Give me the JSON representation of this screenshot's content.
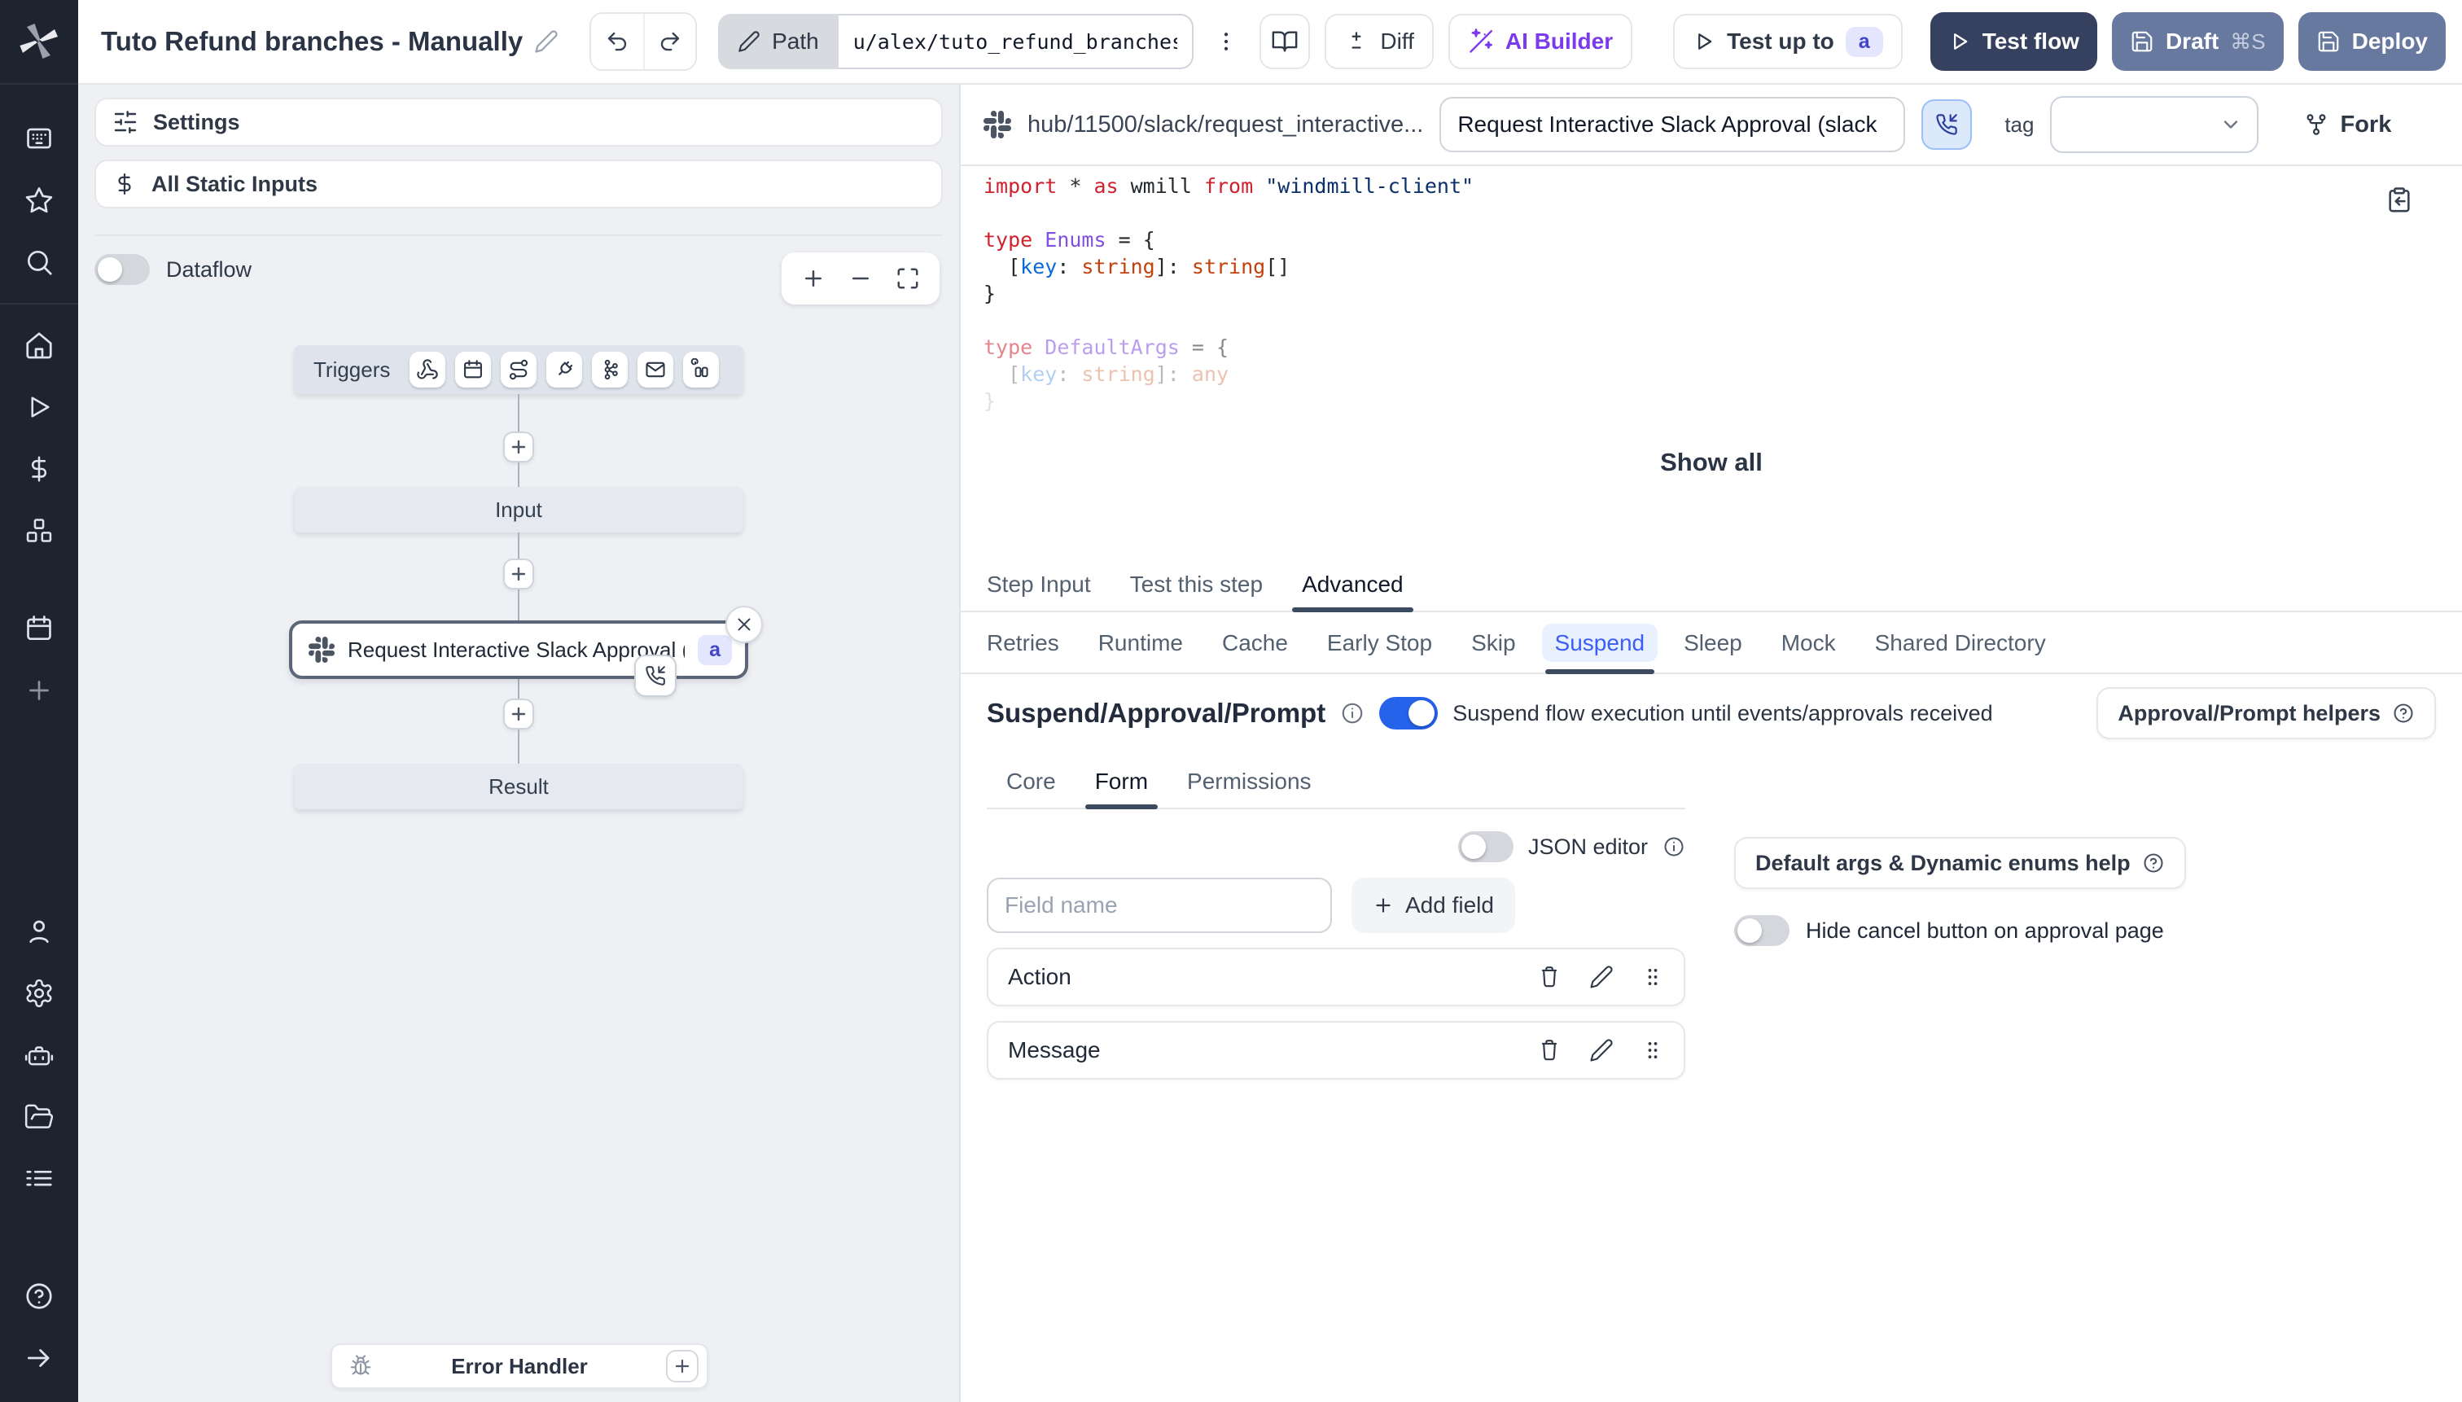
{
  "header": {
    "title": "Tuto Refund branches - Manually",
    "path_label": "Path",
    "path_value": "u/alex/tuto_refund_branches__",
    "diff_label": "Diff",
    "ai_builder_label": "AI Builder",
    "test_up_to_label": "Test up to",
    "test_up_to_badge": "a",
    "test_flow_label": "Test flow",
    "draft_label": "Draft",
    "draft_shortcut": "⌘S",
    "deploy_label": "Deploy"
  },
  "sidebar": {
    "icon_names": [
      "windmill-logo",
      "apps",
      "favorites",
      "search",
      "home",
      "runs",
      "variables",
      "resources",
      "schedules",
      "create",
      "users",
      "settings",
      "workers",
      "folders",
      "logs",
      "help",
      "expand"
    ]
  },
  "flow_panel": {
    "settings_label": "Settings",
    "static_inputs_label": "All Static Inputs",
    "dataflow_label": "Dataflow",
    "graph": {
      "triggers_label": "Triggers",
      "trigger_icon_names": [
        "webhook-icon",
        "schedule-icon",
        "route-icon",
        "websocket-icon",
        "kafka-icon",
        "email-icon",
        "poll-icon"
      ],
      "input_label": "Input",
      "step_label": "Request Interactive Slack Approval (...",
      "step_badge": "a",
      "result_label": "Result",
      "error_handler_label": "Error Handler"
    }
  },
  "step_editor": {
    "hub_path": "hub/11500/slack/request_interactive...",
    "summary_value": "Request Interactive Slack Approval (slack",
    "tag_label": "tag",
    "fork_label": "Fork",
    "show_all_label": "Show all",
    "code": {
      "lines": [
        {
          "tokens": [
            {
              "t": "import",
              "c": "kw"
            },
            {
              "t": " * ",
              "c": "pl"
            },
            {
              "t": "as",
              "c": "kw"
            },
            {
              "t": " wmill ",
              "c": "pl"
            },
            {
              "t": "from",
              "c": "kw"
            },
            {
              "t": " ",
              "c": "pl"
            },
            {
              "t": "\"windmill-client\"",
              "c": "str"
            }
          ]
        },
        {
          "tokens": []
        },
        {
          "tokens": [
            {
              "t": "type",
              "c": "kw"
            },
            {
              "t": " ",
              "c": "pl"
            },
            {
              "t": "Enums",
              "c": "type"
            },
            {
              "t": " = {",
              "c": "pl"
            }
          ]
        },
        {
          "tokens": [
            {
              "t": "  [",
              "c": "pl"
            },
            {
              "t": "key",
              "c": "prop"
            },
            {
              "t": ": ",
              "c": "pl"
            },
            {
              "t": "string",
              "c": "orange"
            },
            {
              "t": "]: ",
              "c": "pl"
            },
            {
              "t": "string",
              "c": "orange"
            },
            {
              "t": "[]",
              "c": "pl"
            }
          ]
        },
        {
          "tokens": [
            {
              "t": "}",
              "c": "pl"
            }
          ]
        },
        {
          "tokens": []
        },
        {
          "fade": 1,
          "tokens": [
            {
              "t": "type",
              "c": "kw"
            },
            {
              "t": " ",
              "c": "pl"
            },
            {
              "t": "DefaultArgs",
              "c": "type"
            },
            {
              "t": " = {",
              "c": "pl"
            }
          ]
        },
        {
          "fade": 2,
          "tokens": [
            {
              "t": "  [",
              "c": "pl"
            },
            {
              "t": "key",
              "c": "prop"
            },
            {
              "t": ": ",
              "c": "pl"
            },
            {
              "t": "string",
              "c": "orange"
            },
            {
              "t": "]: ",
              "c": "pl"
            },
            {
              "t": "any",
              "c": "orange"
            }
          ]
        },
        {
          "fade": 3,
          "tokens": [
            {
              "t": "}",
              "c": "pl"
            }
          ]
        }
      ]
    },
    "tabs": [
      {
        "label": "Step Input",
        "active": false
      },
      {
        "label": "Test this step",
        "active": false
      },
      {
        "label": "Advanced",
        "active": true
      }
    ],
    "advanced_tabs": [
      {
        "label": "Retries",
        "active": false
      },
      {
        "label": "Runtime",
        "active": false
      },
      {
        "label": "Cache",
        "active": false
      },
      {
        "label": "Early Stop",
        "active": false
      },
      {
        "label": "Skip",
        "active": false
      },
      {
        "label": "Suspend",
        "active": true
      },
      {
        "label": "Sleep",
        "active": false
      },
      {
        "label": "Mock",
        "active": false
      },
      {
        "label": "Shared Directory",
        "active": false
      }
    ],
    "suspend": {
      "heading": "Suspend/Approval/Prompt",
      "toggle_on": true,
      "caption": "Suspend flow execution until events/approvals received",
      "helpers_label": "Approval/Prompt helpers",
      "inner_tabs": [
        {
          "label": "Core",
          "active": false
        },
        {
          "label": "Form",
          "active": true
        },
        {
          "label": "Permissions",
          "active": false
        }
      ],
      "json_editor_label": "JSON editor",
      "field_name_placeholder": "Field name",
      "add_field_label": "Add field",
      "fields": [
        "Action",
        "Message"
      ],
      "default_args_help_label": "Default args & Dynamic enums help",
      "hide_cancel_label": "Hide cancel button on approval page"
    }
  },
  "colors": {
    "accent_toggle_blue": "#2563eb",
    "suspend_tab_blue": "#3b5ef8",
    "test_flow_navy": "#364160",
    "draft_deploy_slate": "#67799e",
    "badge_indigo_bg": "#e3e6fc",
    "badge_indigo_text": "#4244c9",
    "sidebar_dark": "#1d2430",
    "panel_gray": "#eef0f4"
  }
}
